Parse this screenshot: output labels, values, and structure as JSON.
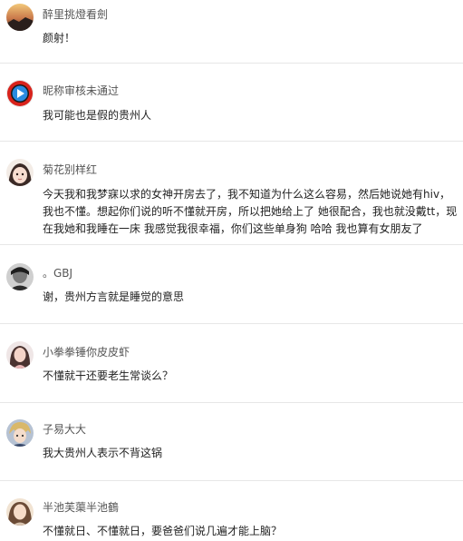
{
  "comments": [
    {
      "username": "醉里挑燈看劍",
      "lines": [
        "颜射！"
      ],
      "avatar": "avatar-dusk-photo"
    },
    {
      "username": "昵称审核未通过",
      "lines": [
        "我可能也是假的贵州人"
      ],
      "avatar": "avatar-play-logo"
    },
    {
      "username": "菊花别样红",
      "lines": [
        "今天我和我梦寐以求的女神开房去了，我不知道为什么这么容易，然后她说她有hiv，",
        "我也不懂。想起你们说的听不懂就开房，所以把她给上了 她很配合，我也就没戴tt，现",
        "在我她和我睡在一床 我感觉我很幸福，你们这些单身狗 哈哈 我也算有女朋友了"
      ],
      "avatar": "avatar-cartoon-face"
    },
    {
      "username": "。GBJ",
      "lines": [
        "谢，贵州方言就是睡觉的意思"
      ],
      "avatar": "avatar-bw-portrait"
    },
    {
      "username": "小拳拳锤你皮皮虾",
      "lines": [
        "不懂就干还要老生常谈么？"
      ],
      "avatar": "avatar-girl-portrait"
    },
    {
      "username": "子易大大",
      "lines": [
        "我大贵州人表示不背这锅"
      ],
      "avatar": "avatar-anime-character"
    },
    {
      "username": "半池芙蕖半池鶴",
      "lines": [
        "不懂就日、不懂就日，要爸爸们说几遍才能上脑？"
      ],
      "avatar": "avatar-girl-photo"
    }
  ],
  "colors": {
    "divider": "#e7e7e7",
    "username": "#555555",
    "body": "#222222"
  }
}
